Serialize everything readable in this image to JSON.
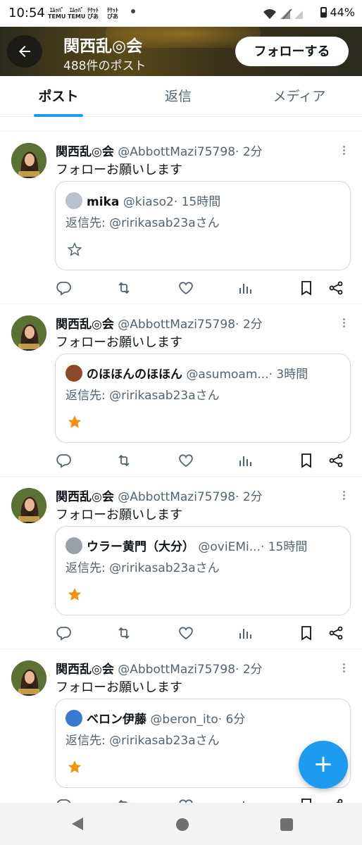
{
  "status_bar": {
    "time": "10:54",
    "apps": [
      {
        "line1": "ｴﾑｯﾊﾞ",
        "line2": "TEMU"
      },
      {
        "line1": "ｴﾑｯﾊﾞ",
        "line2": "TEMU"
      },
      {
        "line1": "ﾁｹｯﾄ",
        "line2": "ぴあ"
      },
      {
        "line1": "ﾁｹｯﾄ",
        "line2": "ぴあ"
      }
    ],
    "battery": "44%"
  },
  "header": {
    "title": "関西乱◎会",
    "subtitle": "488件のポスト",
    "follow_label": "フォローする",
    "back_icon": "arrow-left-icon"
  },
  "tabs": [
    {
      "label": "ポスト",
      "active": true
    },
    {
      "label": "返信",
      "active": false
    },
    {
      "label": "メディア",
      "active": false
    }
  ],
  "tweets": [
    {
      "name": "関西乱◎会",
      "handle": "@AbbottMazi75798",
      "time": "· 2分",
      "text": "フォローお願いします",
      "quote": {
        "name": "mika",
        "handle": "@kiaso2",
        "time": "· 15時間",
        "reply_to": "返信先: @ririkasab23aさん",
        "starred": false,
        "avatar_color": "#b8c2cc"
      }
    },
    {
      "name": "関西乱◎会",
      "handle": "@AbbottMazi75798",
      "time": "· 2分",
      "text": "フォローお願いします",
      "quote": {
        "name": "のほほんのほほん",
        "handle": "@asumoam...",
        "time": "· 3時間",
        "reply_to": "返信先: @ririkasab23aさん",
        "starred": true,
        "avatar_color": "#8a4a2a"
      }
    },
    {
      "name": "関西乱◎会",
      "handle": "@AbbottMazi75798",
      "time": "· 2分",
      "text": "フォローお願いします",
      "quote": {
        "name": "ウラー黄門（大分）",
        "handle": "@oviEMi...",
        "time": "· 15時間",
        "reply_to": "返信先: @ririkasab23aさん",
        "starred": true,
        "avatar_color": "#9aa0a8"
      }
    },
    {
      "name": "関西乱◎会",
      "handle": "@AbbottMazi75798",
      "time": "· 2分",
      "text": "フォローお願いします",
      "quote": {
        "name": "ベロン伊藤",
        "handle": "@beron_ito",
        "time": "· 6分",
        "reply_to": "返信先: @ririkasab23aさん",
        "starred": true,
        "avatar_color": "#3a7ad0"
      }
    }
  ],
  "actions": [
    "reply-icon",
    "retweet-icon",
    "like-icon",
    "views-icon",
    "bookmark-icon",
    "share-icon"
  ],
  "fab_label": "+",
  "colors": {
    "accent": "#1d9bf0",
    "star": "#f4900c",
    "text": "#0f1419",
    "muted": "#536471"
  }
}
